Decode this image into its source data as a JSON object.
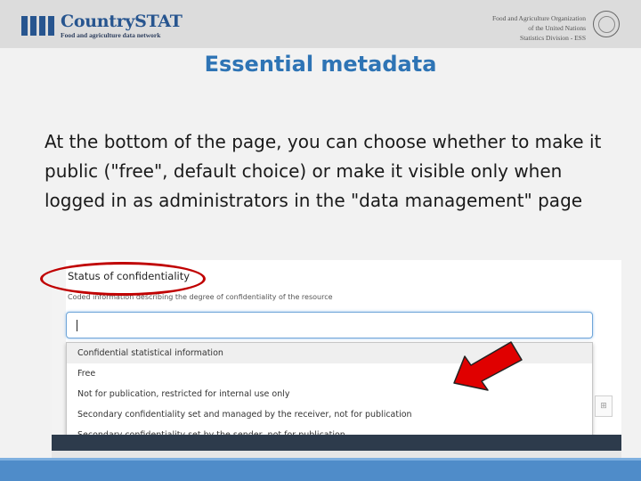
{
  "header": {
    "logo_name": "CountrySTAT",
    "logo_tagline": "Food and agriculture data network",
    "fao_lines": [
      "Food and Agriculture Organization",
      "of the United Nations",
      "Statistics Division - ESS"
    ],
    "brand_color": "#27558f"
  },
  "slide": {
    "title": "Essential metadata",
    "body": "At the bottom of the page, you can choose whether to make it public (\"free\", default choice) or make it visible only when logged in as administrators in the \"data management\" page",
    "title_color": "#2e74b5"
  },
  "form": {
    "field_label": "Status of confidentiality",
    "field_help": "Coded information describing the degree of confidentiality of the resource",
    "input_value": "",
    "options": [
      "Confidential statistical information",
      "Free",
      "Not for publication, restricted for internal use only",
      "Secondary confidentiality set and managed by the receiver, not for publication",
      "Secondary confidentiality set by the sender, not for publication"
    ],
    "highlighted_option_index": 0
  },
  "annotations": {
    "ellipse_color": "#c00000",
    "arrow_color": "#e00000",
    "arrow_target": "Free"
  },
  "icons": {
    "side_icon": "dataset-icon",
    "caret": "text-caret"
  }
}
